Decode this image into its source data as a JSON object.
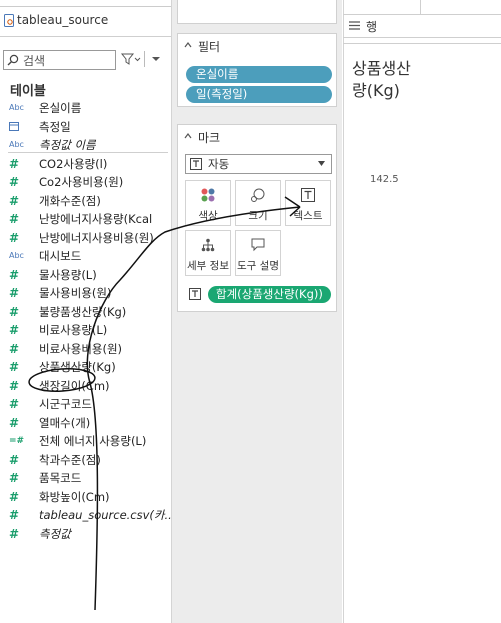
{
  "data_source": {
    "name": "tableau_source"
  },
  "search": {
    "placeholder": "검색"
  },
  "tables": {
    "heading": "테이블",
    "fields": [
      {
        "icon": "abc",
        "label": "온실이름",
        "italic": false
      },
      {
        "icon": "calendar",
        "label": "측정일",
        "italic": false
      },
      {
        "icon": "abc",
        "label": "측정값 이름",
        "italic": true
      },
      {
        "icon": "hash",
        "label": "CO2사용량(l)",
        "italic": false
      },
      {
        "icon": "hash",
        "label": "Co2사용비용(원)",
        "italic": false
      },
      {
        "icon": "hash",
        "label": "개화수준(점)",
        "italic": false
      },
      {
        "icon": "hash",
        "label": "난방에너지사용량(Kcal",
        "italic": false
      },
      {
        "icon": "hash",
        "label": "난방에너지사용비용(원)",
        "italic": false
      },
      {
        "icon": "abc-geo",
        "label": "대시보드",
        "italic": false
      },
      {
        "icon": "hash",
        "label": "물사용량(L)",
        "italic": false
      },
      {
        "icon": "hash",
        "label": "물사용비용(원)",
        "italic": false
      },
      {
        "icon": "hash",
        "label": "불량품생산량(Kg)",
        "italic": false
      },
      {
        "icon": "hash",
        "label": "비료사용량(L)",
        "italic": false
      },
      {
        "icon": "hash",
        "label": "비료사용비용(원)",
        "italic": false
      },
      {
        "icon": "hash",
        "label": "상품생산량(Kg)",
        "italic": false
      },
      {
        "icon": "hash",
        "label": "생장길이(Cm)",
        "italic": false
      },
      {
        "icon": "hash",
        "label": "시군구코드",
        "italic": false
      },
      {
        "icon": "hash",
        "label": "열매수(개)",
        "italic": false
      },
      {
        "icon": "hash-calc",
        "label": "전체 에너지 사용량(L)",
        "italic": false
      },
      {
        "icon": "hash",
        "label": "착과수준(점)",
        "italic": false
      },
      {
        "icon": "hash",
        "label": "품목코드",
        "italic": false
      },
      {
        "icon": "hash",
        "label": "화방높이(Cm)",
        "italic": false
      },
      {
        "icon": "hash",
        "label": "tableau_source.csv(카...",
        "italic": true
      },
      {
        "icon": "hash",
        "label": "측정값",
        "italic": true
      }
    ]
  },
  "filters": {
    "title": "필터",
    "pills": [
      "온실이름",
      "일(측정일)"
    ]
  },
  "marks": {
    "title": "마크",
    "type": "자동",
    "buttons": [
      {
        "label": "색상",
        "icon": "color-dots-icon"
      },
      {
        "label": "크기",
        "icon": "size-circles-icon"
      },
      {
        "label": "텍스트",
        "icon": "text-box-icon"
      },
      {
        "label": "세부 정보",
        "icon": "detail-tree-icon"
      },
      {
        "label": "도구 설명",
        "icon": "tooltip-bubble-icon"
      }
    ],
    "field_pill": "합계(상품생산량(Kg))"
  },
  "rows_shelf": {
    "label": "행"
  },
  "view": {
    "header": "상품생산량(Kg)",
    "value": "142.5"
  }
}
